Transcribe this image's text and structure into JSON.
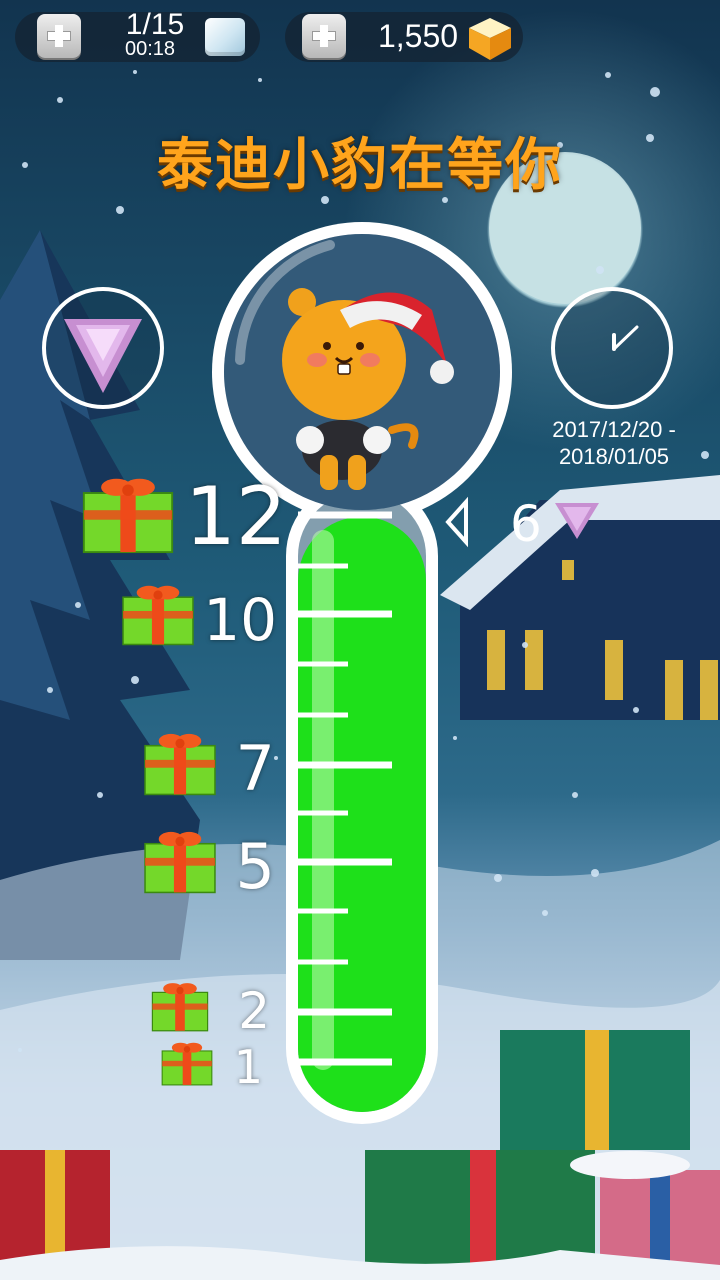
{
  "hud": {
    "lives_add": "add-lives",
    "lives_count": "1/15",
    "lives_timer": "00:18",
    "coins_add": "add-coins",
    "coins": "1,550"
  },
  "title": "泰迪小豹在等你",
  "event": {
    "date_start": "2017/12/20 -",
    "date_end": "2018/01/05",
    "current_level": "6",
    "progress_fraction": 0.96
  },
  "milestones": [
    {
      "label": "12"
    },
    {
      "label": "10"
    },
    {
      "label": "7"
    },
    {
      "label": "5"
    },
    {
      "label": "2"
    },
    {
      "label": "1"
    }
  ],
  "colors": {
    "fill": "#1ee01a",
    "title": "#ffa41c",
    "gem": "#c78fd1"
  },
  "icons": {
    "left_button": "gem-triangle-icon",
    "right_button": "clock-icon",
    "reward": "gift-box-icon"
  }
}
